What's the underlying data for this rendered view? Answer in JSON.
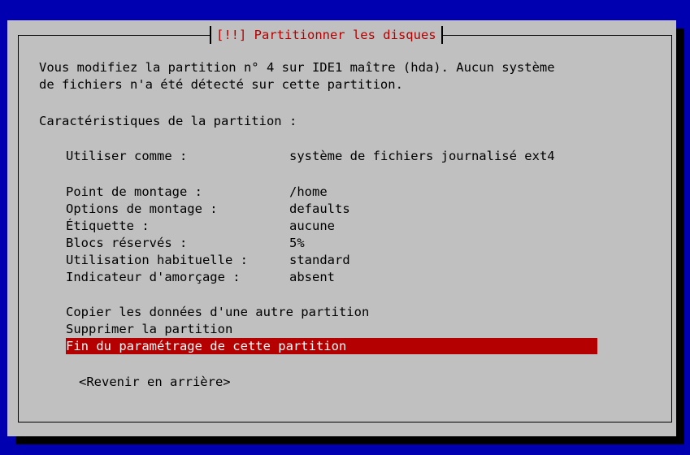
{
  "dialog": {
    "title": "[!!] Partitionner les disques",
    "intro_line1": "Vous modifiez la partition n° 4 sur IDE1 maître (hda). Aucun système",
    "intro_line2": "de fichiers n'a été détecté sur cette partition.",
    "section_heading": "Caractéristiques de la partition :",
    "settings": [
      {
        "label": "Utiliser comme :",
        "value": "système de fichiers journalisé ext4"
      },
      {
        "label": "Point de montage :",
        "value": "/home"
      },
      {
        "label": "Options de montage :",
        "value": "defaults"
      },
      {
        "label": "Étiquette :",
        "value": "aucune"
      },
      {
        "label": "Blocs réservés :",
        "value": "5%"
      },
      {
        "label": "Utilisation habituelle :",
        "value": "standard"
      },
      {
        "label": "Indicateur d'amorçage :",
        "value": "absent"
      }
    ],
    "actions": [
      {
        "label": "Copier les données d'une autre partition"
      },
      {
        "label": "Supprimer la partition"
      },
      {
        "label": "Fin du paramétrage de cette partition",
        "selected": true
      }
    ],
    "back_button": "<Revenir en arrière>"
  },
  "colors": {
    "background": "#0000b0",
    "dialog": "#c0c0c0",
    "title": "#b40000",
    "selection": "#b40000",
    "selection_text": "#ffffff"
  }
}
